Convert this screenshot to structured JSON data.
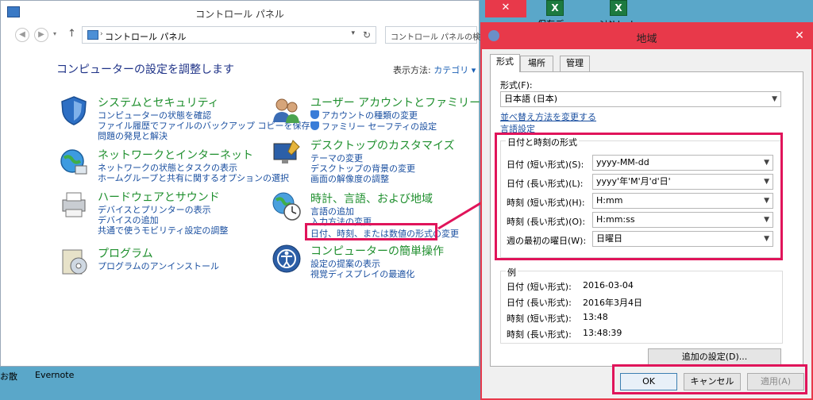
{
  "desktop": {
    "icons": [
      {
        "label": "保存データ.xls"
      },
      {
        "label": "ﾐﾅｷkk.xls"
      }
    ],
    "taskbar": [
      {
        "label": "お散"
      },
      {
        "label": "Evernote"
      }
    ]
  },
  "control_panel": {
    "title": "コントロール パネル",
    "address": "コントロール パネル",
    "search_placeholder": "コントロール パネルの検索",
    "heading": "コンピューターの設定を調整します",
    "view_by_label": "表示方法:",
    "view_by_value": "カテゴリ ▾",
    "categories": [
      {
        "title": "システムとセキュリティ",
        "links": [
          "コンピューターの状態を確認",
          "ファイル履歴でファイルのバックアップ コピーを保存",
          "問題の発見と解決"
        ]
      },
      {
        "title": "ネットワークとインターネット",
        "links": [
          "ネットワークの状態とタスクの表示",
          "ホームグループと共有に関するオプションの選択"
        ]
      },
      {
        "title": "ハードウェアとサウンド",
        "links": [
          "デバイスとプリンターの表示",
          "デバイスの追加",
          "共通で使うモビリティ設定の調整"
        ]
      },
      {
        "title": "プログラム",
        "links": [
          "プログラムのアンインストール"
        ]
      },
      {
        "title": "ユーザー アカウントとファミリー セーフティ",
        "links": [
          "アカウントの種類の変更",
          "ファミリー セーフティの設定"
        ]
      },
      {
        "title": "デスクトップのカスタマイズ",
        "links": [
          "テーマの変更",
          "デスクトップの背景の変更",
          "画面の解像度の調整"
        ]
      },
      {
        "title": "時計、言語、および地域",
        "links": [
          "言語の追加",
          "入力方法の変更",
          "日付、時刻、または数値の形式の変更"
        ]
      },
      {
        "title": "コンピューターの簡単操作",
        "links": [
          "設定の提案の表示",
          "視覚ディスプレイの最適化"
        ]
      }
    ]
  },
  "region_dialog": {
    "title": "地域",
    "tabs": [
      "形式",
      "場所",
      "管理"
    ],
    "format_label": "形式(F):",
    "format_value": "日本語 (日本)",
    "link_sort": "並べ替え方法を変更する",
    "link_language": "言語設定",
    "datetime_group_title": "日付と時刻の形式",
    "fields": [
      {
        "label": "日付 (短い形式)(S):",
        "value": "yyyy-MM-dd"
      },
      {
        "label": "日付 (長い形式)(L):",
        "value": "yyyy'年'M'月'd'日'"
      },
      {
        "label": "時刻 (短い形式)(H):",
        "value": "H:mm"
      },
      {
        "label": "時刻 (長い形式)(O):",
        "value": "H:mm:ss"
      },
      {
        "label": "週の最初の曜日(W):",
        "value": "日曜日"
      }
    ],
    "examples_title": "例",
    "examples": [
      {
        "label": "日付 (短い形式):",
        "value": "2016-03-04"
      },
      {
        "label": "日付 (長い形式):",
        "value": "2016年3月4日"
      },
      {
        "label": "時刻 (短い形式):",
        "value": "13:48"
      },
      {
        "label": "時刻 (長い形式):",
        "value": "13:48:39"
      }
    ],
    "additional_settings": "追加の設定(D)...",
    "ok": "OK",
    "cancel": "キャンセル",
    "apply": "適用(A)"
  },
  "colors": {
    "highlight": "#e0145a",
    "dialog_titlebar": "#e8394a",
    "link": "#1a4fa0",
    "category_title": "#1f8f2e"
  }
}
